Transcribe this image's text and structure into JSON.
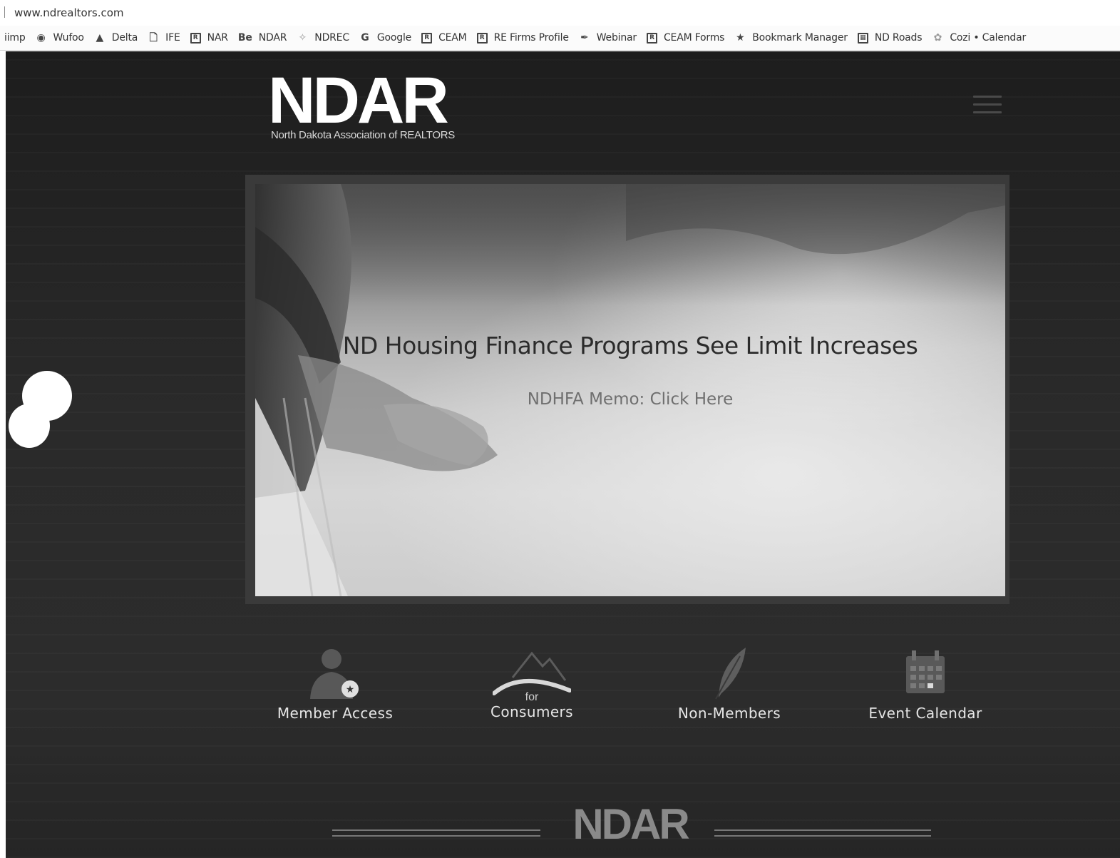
{
  "browser": {
    "url": "www.ndrealtors.com",
    "bookmarks": [
      {
        "label": "iimp",
        "icon": ""
      },
      {
        "label": "Wufoo",
        "icon": "wufoo-icon"
      },
      {
        "label": "Delta",
        "icon": "delta-icon"
      },
      {
        "label": "IFE",
        "icon": "page-icon"
      },
      {
        "label": "NAR",
        "icon": "realtor-r-icon"
      },
      {
        "label": "NDAR",
        "icon": "behance-icon"
      },
      {
        "label": "NDREC",
        "icon": "ndrec-icon"
      },
      {
        "label": "Google",
        "icon": "google-icon"
      },
      {
        "label": "CEAM",
        "icon": "realtor-r-icon"
      },
      {
        "label": "RE Firms Profile",
        "icon": "realtor-r-icon"
      },
      {
        "label": "Webinar",
        "icon": "pen-icon"
      },
      {
        "label": "CEAM Forms",
        "icon": "realtor-r-icon"
      },
      {
        "label": "Bookmark Manager",
        "icon": "star-icon"
      },
      {
        "label": "ND Roads",
        "icon": "roads-icon"
      },
      {
        "label": "Cozi • Calendar",
        "icon": "cozi-icon"
      }
    ]
  },
  "site": {
    "logo": {
      "main": "NDAR",
      "sub": "North Dakota Association of REALTORS"
    },
    "hero": {
      "title": "ND Housing Finance Programs See Limit Increases",
      "link": "NDHFA Memo: Click Here"
    },
    "quick_links": [
      {
        "label": "Member Access",
        "pre": ""
      },
      {
        "label": "Consumers",
        "pre": "for"
      },
      {
        "label": "Non-Members",
        "pre": ""
      },
      {
        "label": "Event Calendar",
        "pre": ""
      }
    ],
    "footer_logo": "NDAR"
  }
}
